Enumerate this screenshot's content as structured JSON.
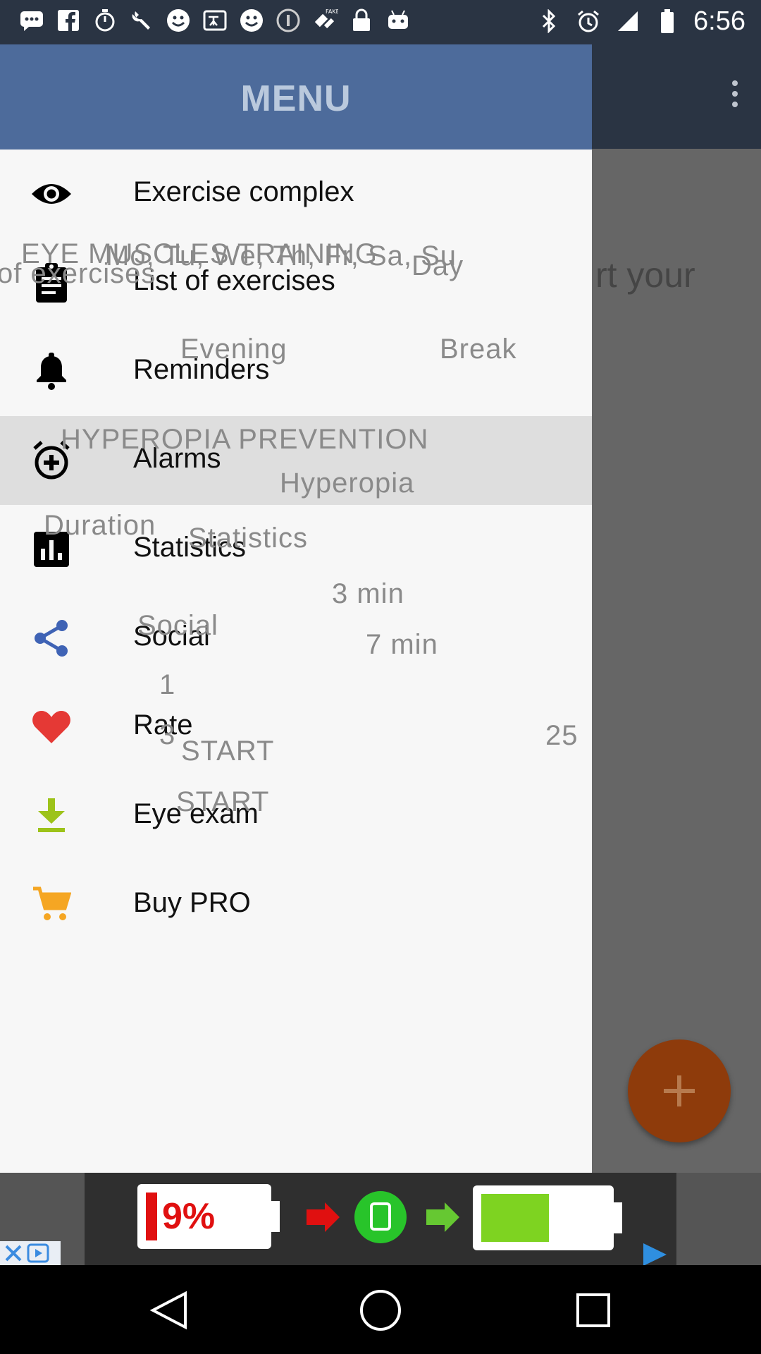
{
  "status_bar": {
    "time": "6:56",
    "icons": [
      "messages-icon",
      "facebook-icon",
      "timer-icon",
      "wrench-icon",
      "smiley-icon",
      "translate-icon",
      "smiley-icon",
      "info-icon",
      "fake-gps-icon",
      "lock-icon",
      "android-icon",
      "bluetooth-icon",
      "alarm-icon",
      "signal-icon",
      "battery-icon"
    ]
  },
  "drawer": {
    "title": "MENU",
    "items": [
      {
        "label": "Exercise complex",
        "icon": "eye-icon",
        "active": false
      },
      {
        "label": "List of exercises",
        "icon": "clipboard-icon",
        "active": false
      },
      {
        "label": "Reminders",
        "icon": "bell-icon",
        "active": false
      },
      {
        "label": "Alarms",
        "icon": "alarm-add-icon",
        "active": true
      },
      {
        "label": "Statistics",
        "icon": "bar-chart-icon",
        "active": false
      },
      {
        "label": "Social",
        "icon": "share-icon",
        "active": false
      },
      {
        "label": "Rate",
        "icon": "heart-icon",
        "active": false
      },
      {
        "label": "Eye exam",
        "icon": "download-icon",
        "active": false
      },
      {
        "label": "Buy PRO",
        "icon": "cart-icon",
        "active": false
      }
    ]
  },
  "ghost_text": {
    "eye_muscles": "EYE MUSCLES TRAINING",
    "days": "Mo, Tu, We, Th, Fr, Sa, Su",
    "day": "Day",
    "of_exercises": "of exercises",
    "evening": "Evening",
    "break": "Break",
    "hyperopia_prevention": "HYPEROPIA PREVENTION",
    "hyperopia": "Hyperopia",
    "duration": "Duration",
    "statistics": "Statistics",
    "three_min": "3 min",
    "social": "Social",
    "seven_min": "7 min",
    "one": "1",
    "twenty_five": "25",
    "three": "3",
    "start_1": "START",
    "start_2": "START"
  },
  "background": {
    "partial_text": "rt your"
  },
  "ad": {
    "battery_low": "9%"
  },
  "colors": {
    "drawer_header": "#4d6b9b",
    "toolbar": "#2a3443",
    "fab": "#8e3b0b",
    "heart": "#e53935",
    "share": "#3f63b5",
    "download": "#9dc31a",
    "cart": "#f5a623"
  }
}
